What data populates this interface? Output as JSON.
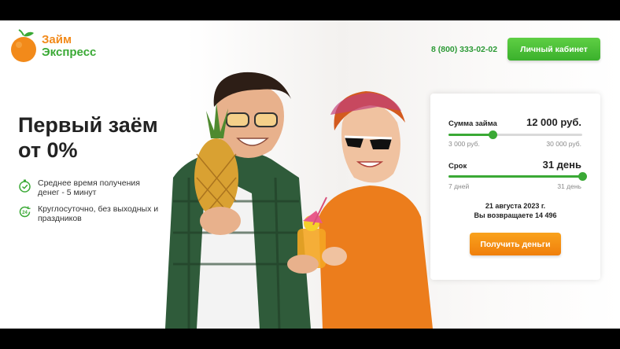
{
  "brand": {
    "line1": "Займ",
    "line2": "Экспресс"
  },
  "header": {
    "phone": "8 (800) 333-02-02",
    "cabinet_label": "Личный кабинет"
  },
  "hero": {
    "headline_line1": "Первый заём",
    "headline_line2": "от 0%",
    "features": [
      {
        "icon": "stopwatch-icon",
        "text": "Среднее время получения денег - 5 минут"
      },
      {
        "icon": "24-hours-icon",
        "text": "Круглосуточно, без выходных и праздников"
      }
    ]
  },
  "calculator": {
    "amount": {
      "label": "Сумма займа",
      "value": "12 000 руб.",
      "min": "3 000 руб.",
      "max": "30 000 руб.",
      "fraction": 0.33
    },
    "term": {
      "label": "Срок",
      "value": "31 день",
      "min": "7 дней",
      "max": "31 день",
      "fraction": 1.0
    },
    "date_text": "21 августа 2023 г.",
    "return_text": "Вы возвращаете 14 496",
    "submit_label": "Получить деньги"
  },
  "colors": {
    "green": "#3aa935",
    "orange": "#f28a1a"
  }
}
